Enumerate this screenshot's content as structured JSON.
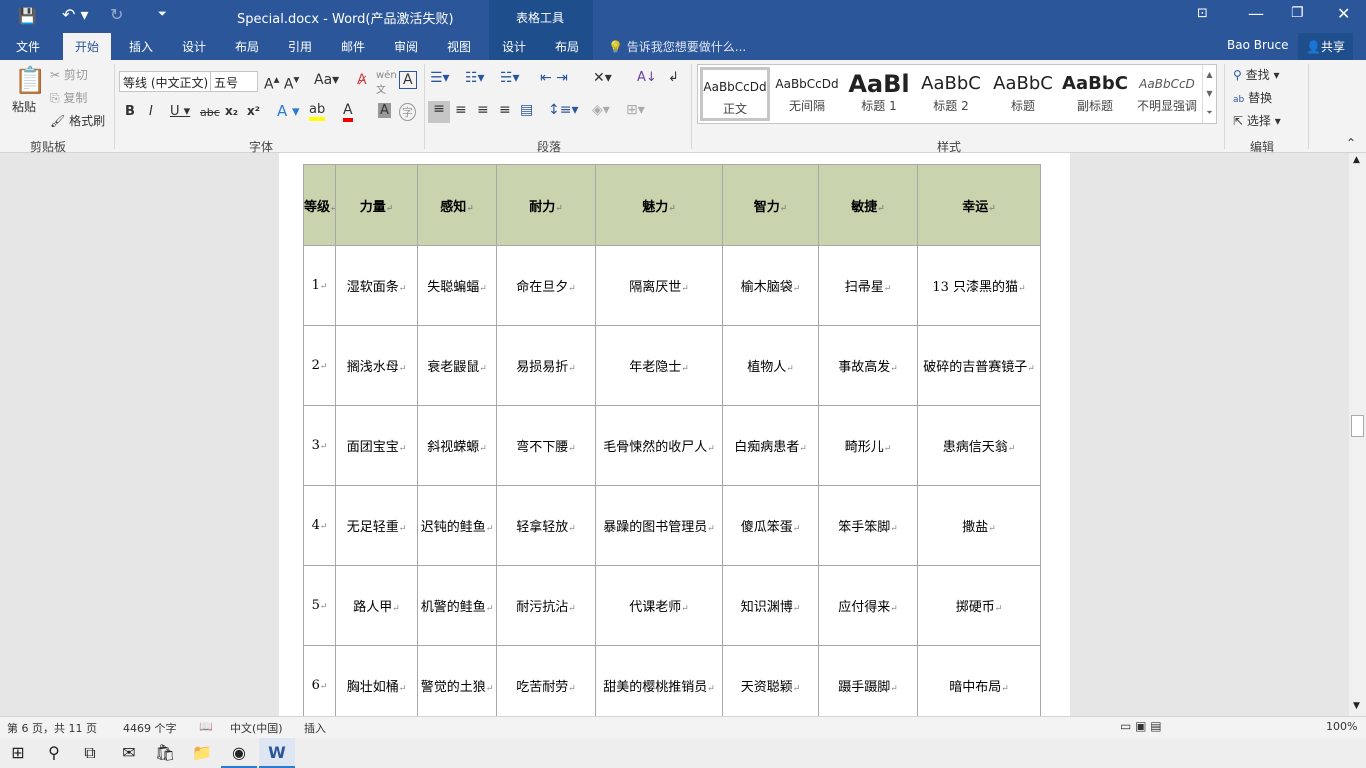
{
  "window": {
    "title": "Special.docx - Word(产品激活失败)",
    "context_tab_group": "表格工具",
    "user": "Bao Bruce",
    "share": "共享"
  },
  "tabs": [
    "文件",
    "开始",
    "插入",
    "设计",
    "布局",
    "引用",
    "邮件",
    "审阅",
    "视图",
    "设计",
    "布局"
  ],
  "tell_me": "告诉我您想要做什么...",
  "ribbon": {
    "clipboard": {
      "paste": "粘贴",
      "cut": "剪切",
      "copy": "复制",
      "format_painter": "格式刷",
      "label": "剪贴板"
    },
    "font": {
      "name": "等线 (中文正文)",
      "size": "五号",
      "label": "字体"
    },
    "paragraph": {
      "label": "段落"
    },
    "styles": {
      "items": [
        {
          "sample": "AaBbCcDd",
          "name": "正文"
        },
        {
          "sample": "AaBbCcDd",
          "name": "无间隔"
        },
        {
          "sample": "AaBl",
          "name": "标题 1"
        },
        {
          "sample": "AaBbC",
          "name": "标题 2"
        },
        {
          "sample": "AaBbC",
          "name": "标题"
        },
        {
          "sample": "AaBbC",
          "name": "副标题"
        },
        {
          "sample": "AaBbCcD",
          "name": "不明显强调"
        }
      ],
      "label": "样式"
    },
    "editing": {
      "find": "查找",
      "replace": "替换",
      "select": "选择",
      "label": "编辑"
    }
  },
  "table": {
    "headers": [
      "等级",
      "力量",
      "感知",
      "耐力",
      "魅力",
      "智力",
      "敏捷",
      "幸运"
    ],
    "rows": [
      [
        "1",
        "湿软面条",
        "失聪蝙蝠",
        "命在旦夕",
        "隔离厌世",
        "榆木脑袋",
        "扫帚星",
        "13 只漆黑的猫"
      ],
      [
        "2",
        "搁浅水母",
        "衰老鼹鼠",
        "易损易折",
        "年老隐士",
        "植物人",
        "事故高发",
        "破碎的吉普赛镜子"
      ],
      [
        "3",
        "面团宝宝",
        "斜视蝾螈",
        "弯不下腰",
        "毛骨悚然的收尸人",
        "白痴病患者",
        "畸形儿",
        "患病信天翁"
      ],
      [
        "4",
        "无足轻重",
        "迟钝的鲑鱼",
        "轻拿轻放",
        "暴躁的图书管理员",
        "傻瓜笨蛋",
        "笨手笨脚",
        "撒盐"
      ],
      [
        "5",
        "路人甲",
        "机警的鲑鱼",
        "耐污抗沾",
        "代课老师",
        "知识渊博",
        "应付得来",
        "掷硬币"
      ],
      [
        "6",
        "胸壮如桶",
        "警觉的土狼",
        "吃苦耐劳",
        "甜美的樱桃推销员",
        "天资聪颖",
        "蹑手蹑脚",
        "暗中布局"
      ]
    ]
  },
  "status": {
    "page": "第 6 页，共 11 页",
    "words": "4469 个字",
    "language": "中文(中国)",
    "mode": "插入",
    "zoom": "100%"
  },
  "colors": {
    "brand": "#2b579a",
    "header_fill": "#c9d3ad"
  }
}
